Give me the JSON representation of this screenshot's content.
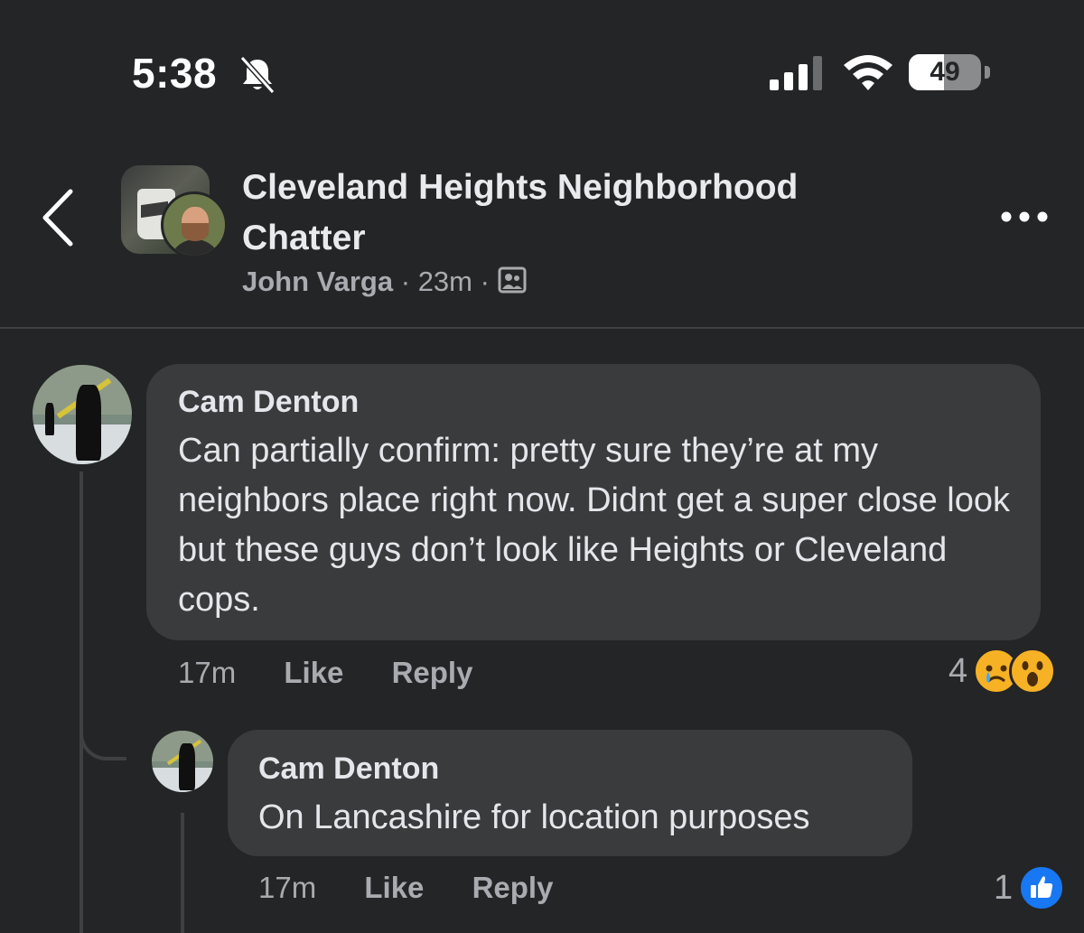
{
  "status_bar": {
    "time": "5:38",
    "battery": "49",
    "battery_fraction": 0.49,
    "icons": [
      "bell-slash-icon",
      "cellular-signal-icon",
      "wifi-icon",
      "battery-icon"
    ]
  },
  "header": {
    "group_name": "Cleveland Heights Neighborhood Chatter",
    "author": "John Varga",
    "separator": "·",
    "time": "23m",
    "icons": [
      "back-chevron-icon",
      "group-privacy-icon",
      "more-options-icon"
    ]
  },
  "comments": [
    {
      "author": "Cam Denton",
      "text": "Can partially confirm: pretty sure they’re at my neighbors place right now. Didnt get a super close look but these guys don’t look like Heights or Cleveland cops.",
      "time": "17m",
      "like_label": "Like",
      "reply_label": "Reply",
      "reaction_count": "4",
      "reactions": [
        "sad-reaction-icon",
        "wow-reaction-icon"
      ]
    },
    {
      "author": "Cam Denton",
      "text": "On Lancashire for location purposes",
      "time": "17m",
      "like_label": "Like",
      "reply_label": "Reply",
      "reaction_count": "1",
      "reactions": [
        "like-reaction-icon"
      ]
    }
  ],
  "colors": {
    "background": "#242526",
    "bubble": "#3a3b3c",
    "text_primary": "#e4e6eb",
    "text_secondary": "#a8abaf",
    "like_blue": "#1877f2",
    "reaction_yellow": "#f7b125"
  }
}
